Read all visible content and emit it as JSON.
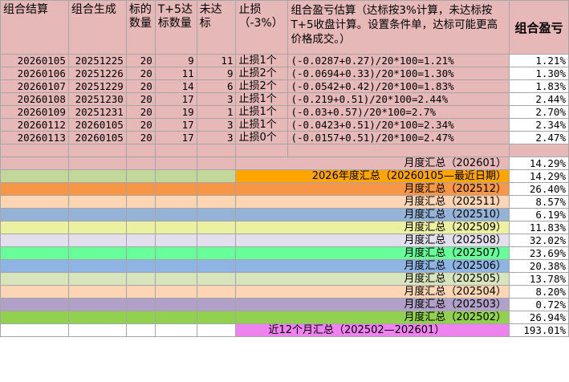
{
  "headers": {
    "col1": "组合结算",
    "col2": "组合生成",
    "col3": "标的数量",
    "col4": "T+5达标数量",
    "col5": "未达标",
    "col6": "止损（-3%）",
    "col7": "组合盈亏估算（达标按3%计算，未达标按T+5收盘计算。设置条件单，达标可能更高价格成交。）",
    "col8": "组合盈亏"
  },
  "rows": [
    {
      "settle": "20260105",
      "gen": "20251225",
      "count": "20",
      "hit": "9",
      "miss": "11",
      "stop": "止损1个",
      "formula": "(-0.0287+0.27)/20*100=1.21%",
      "pnl": "1.21%"
    },
    {
      "settle": "20260106",
      "gen": "20251226",
      "count": "20",
      "hit": "11",
      "miss": "9",
      "stop": "止损2个",
      "formula": "(-0.0694+0.33)/20*100=1.30%",
      "pnl": "1.30%"
    },
    {
      "settle": "20260107",
      "gen": "20251229",
      "count": "20",
      "hit": "14",
      "miss": "6",
      "stop": "止损2个",
      "formula": "(-0.0542+0.42)/20*100=1.83%",
      "pnl": "1.83%"
    },
    {
      "settle": "20260108",
      "gen": "20251230",
      "count": "20",
      "hit": "17",
      "miss": "3",
      "stop": "止损1个",
      "formula": "(-0.219+0.51)/20*100=2.44%",
      "pnl": "2.44%"
    },
    {
      "settle": "20260109",
      "gen": "20251231",
      "count": "20",
      "hit": "19",
      "miss": "1",
      "stop": "止损1个",
      "formula": "(-0.03+0.57)/20*100=2.7%",
      "pnl": "2.70%"
    },
    {
      "settle": "20260112",
      "gen": "20260105",
      "count": "20",
      "hit": "17",
      "miss": "3",
      "stop": "止损1个",
      "formula": "(-0.0423+0.51)/20*100=2.34%",
      "pnl": "2.34%"
    },
    {
      "settle": "20260113",
      "gen": "20260105",
      "count": "20",
      "hit": "17",
      "miss": "3",
      "stop": "止损0个",
      "formula": "(-0.0157+0.51)/20*100=2.47%",
      "pnl": "2.47%"
    }
  ],
  "summaries": [
    {
      "label": "月度汇总（202601）",
      "value": "14.29%",
      "color": "#e6b9b8",
      "label_color": "#e6b9b8"
    },
    {
      "label": "2026年度汇总（20260105—最近日期）",
      "value": "14.29%",
      "color": "#c4d79b",
      "label_color": "#ffa500"
    },
    {
      "label": "月度汇总（202512）",
      "value": "26.40%",
      "color": "#f79646",
      "label_color": "#f79646"
    },
    {
      "label": "月度汇总（202511）",
      "value": "8.57%",
      "color": "#fcd5b4",
      "label_color": "#fcd5b4"
    },
    {
      "label": "月度汇总（202510）",
      "value": "6.19%",
      "color": "#95b3d7",
      "label_color": "#95b3d7"
    },
    {
      "label": "月度汇总（202509）",
      "value": "11.83%",
      "color": "#ebf1a0",
      "label_color": "#ebf1a0"
    },
    {
      "label": "月度汇总（202508）",
      "value": "32.02%",
      "color": "#e4dfec",
      "label_color": "#e4dfec"
    },
    {
      "label": "月度汇总（202507）",
      "value": "23.69%",
      "color": "#66ff99",
      "label_color": "#66ff99"
    },
    {
      "label": "月度汇总（202506）",
      "value": "20.38%",
      "color": "#8db4e2",
      "label_color": "#8db4e2"
    },
    {
      "label": "月度汇总（202505）",
      "value": "13.78%",
      "color": "#d8e4bc",
      "label_color": "#d8e4bc"
    },
    {
      "label": "月度汇总（202504）",
      "value": "8.20%",
      "color": "#fcd5b4",
      "label_color": "#fcd5b4"
    },
    {
      "label": "月度汇总（202503）",
      "value": "0.72%",
      "color": "#b1a0c7",
      "label_color": "#b1a0c7"
    },
    {
      "label": "月度汇总（202502）",
      "value": "26.94%",
      "color": "#92d050",
      "label_color": "#92d050"
    },
    {
      "label": "近12个月汇总（202502—202601）",
      "value": "193.01%",
      "color": "#ffffff",
      "label_color": "#ee82ee"
    }
  ],
  "colors": {
    "header_bg": "#e6b9b8",
    "data_bg": "#e6b9b8",
    "grid_line": "#a6a6a6"
  }
}
